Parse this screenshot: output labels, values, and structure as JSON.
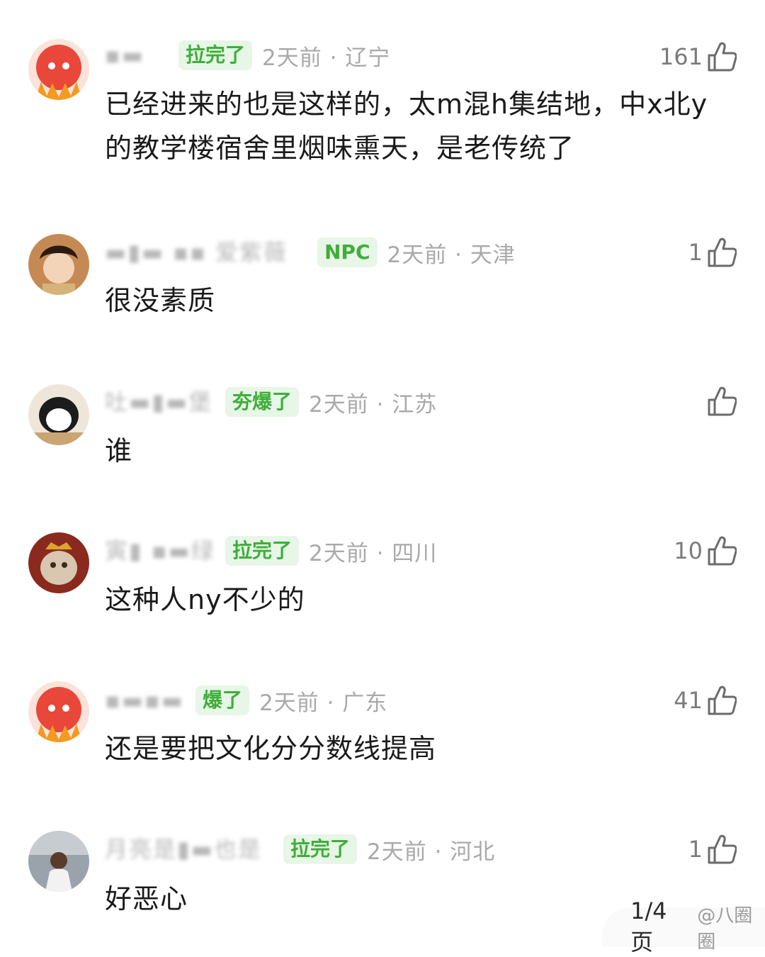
{
  "comments": [
    {
      "username": "▪▬",
      "badge": "拉完了",
      "meta": "2天前 · 辽宁",
      "likes": "161",
      "text": "已经进来的也是这样的，太m混h集结地，中x北y的教学楼宿舍里烟味熏天，是老传统了"
    },
    {
      "username": "▬▮▬ ▪▪ 爱紫薇",
      "badge": "NPC",
      "meta": "2天前 · 天津",
      "likes": "1",
      "text": "很没素质"
    },
    {
      "username": "吐▬▮▬堡",
      "badge": "夯爆了",
      "meta": "2天前 · 江苏",
      "likes": "",
      "text": "谁"
    },
    {
      "username": "寅▮ ▪▬绿",
      "badge": "拉完了",
      "meta": "2天前 · 四川",
      "likes": "10",
      "text": "这种人ny不少的"
    },
    {
      "username": "▪▬▪▬",
      "badge": "爆了",
      "meta": "2天前 · 广东",
      "likes": "41",
      "text": "还是要把文化分分数线提高"
    },
    {
      "username": "月亮是▮▬也是",
      "badge": "拉完了",
      "meta": "2天前 · 河北",
      "likes": "1",
      "text": "好恶心"
    }
  ],
  "watermark": {
    "page": "1/4 页",
    "source": "@八圈圈"
  },
  "colors": {
    "badge_text": "#3fae3a",
    "badge_bg": "#e7f6e7",
    "meta": "#a9a9a9"
  }
}
